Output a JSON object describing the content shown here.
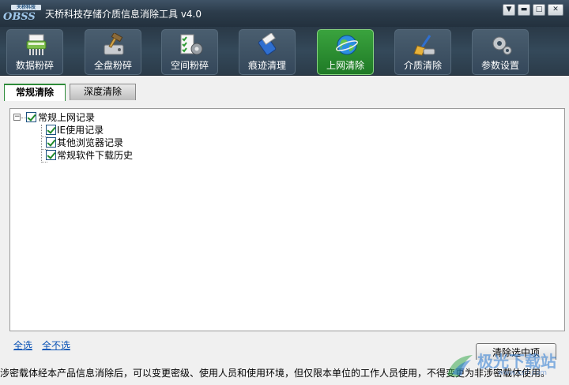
{
  "window": {
    "logo_top": "天桥科技",
    "logo_word": "OBSS",
    "title": "天桥科技存储介质信息消除工具 v4.0",
    "controls": [
      "▼",
      "▬",
      "□",
      "✕"
    ]
  },
  "toolbar": {
    "items": [
      {
        "label": "数据粉碎",
        "icon": "shredder-icon"
      },
      {
        "label": "全盘粉碎",
        "icon": "disk-hammer-icon"
      },
      {
        "label": "空间粉碎",
        "icon": "checklist-gear-icon"
      },
      {
        "label": "痕迹清理",
        "icon": "eraser-icon"
      },
      {
        "label": "上网清除",
        "icon": "globe-icon"
      },
      {
        "label": "介质清除",
        "icon": "broom-icon"
      },
      {
        "label": "参数设置",
        "icon": "gear-icon"
      }
    ],
    "active_index": 4
  },
  "tabs": [
    {
      "label": "常规清除",
      "active": true
    },
    {
      "label": "深度清除",
      "active": false
    }
  ],
  "tree": {
    "root": {
      "label": "常规上网记录",
      "checked": true,
      "expander": "−"
    },
    "children": [
      {
        "label": "IE使用记录",
        "checked": true
      },
      {
        "label": "其他浏览器记录",
        "checked": true
      },
      {
        "label": "常规软件下载历史",
        "checked": true
      }
    ]
  },
  "links": {
    "select_all": "全选",
    "select_none": "全不选"
  },
  "buttons": {
    "exit": "清除选中项"
  },
  "status": "涉密载体经本产品信息消除后，可以变更密级、使用人员和使用环境，但仅限本单位的工作人员使用，不得变更为非涉密载体使用。",
  "watermark": {
    "text": "极光下载站",
    "sub": "www.xz7.com"
  },
  "colors": {
    "accent_green": "#2e9b34",
    "toolbar_bg": "#2e4050",
    "link": "#0a52b5"
  }
}
